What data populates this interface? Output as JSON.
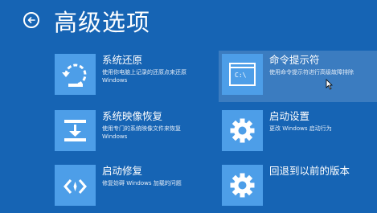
{
  "header": {
    "title": "高级选项"
  },
  "options": [
    {
      "title": "系统还原",
      "desc": "使用你电脑上记录的还原点来还原 Windows",
      "icon": "system-restore-icon"
    },
    {
      "title": "命令提示符",
      "desc": "使用命令提示符进行高级故障排除",
      "icon": "command-prompt-icon"
    },
    {
      "title": "系统映像恢复",
      "desc": "使用专门的系统映像文件来恢复 Windows",
      "icon": "system-image-icon"
    },
    {
      "title": "启动设置",
      "desc": "更改 Windows 启动行为",
      "icon": "gear-icon"
    },
    {
      "title": "启动修复",
      "desc": "修复妨碍 Windows 加载的问题",
      "icon": "startup-repair-icon"
    },
    {
      "title": "回退到以前的版本",
      "desc": "",
      "icon": "gear-icon"
    }
  ],
  "cmd_icon_text": "C:\\",
  "colors": {
    "background": "#1664b4",
    "tile": "#4d9ee8",
    "text": "#ffffff"
  }
}
